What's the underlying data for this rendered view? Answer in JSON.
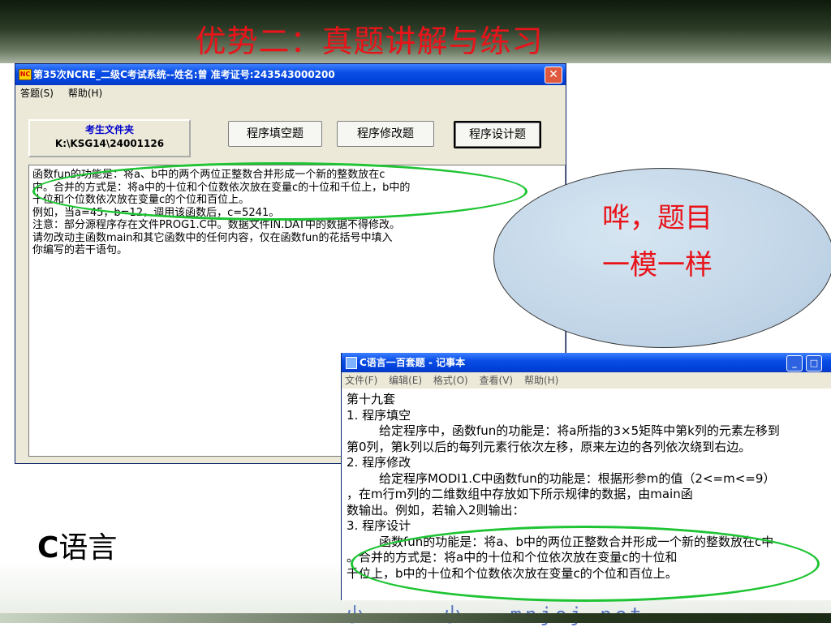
{
  "slide": {
    "title": "优势二：真题讲解与练习",
    "bubble_line1": "哗，题目",
    "bubble_line2": "一模一样",
    "lang_c": "C",
    "lang_rest": "语言"
  },
  "exam_window": {
    "title": "第35次NCRE_二级C考试系统--姓名:曾  准考证号:243543000200",
    "icon": "ncre-app-icon",
    "menu": [
      "答题(S)",
      "帮助(H)"
    ],
    "folder_label": "考生文件夹",
    "folder_path": "K:\\KSG14\\24001126",
    "tabs": [
      "程序填空题",
      "程序修改题",
      "程序设计题"
    ],
    "content": [
      "    函数fun的功能是：将a、b中的两个两位正整数合并形成一个新的整数放在c",
      "中。合并的方式是：将a中的十位和个位数依次放在变量c的十位和千位上，b中的",
      "十位和个位数依次放在变量c的个位和百位上。",
      "    例如，当a=45，b=12，调用该函数后，c=5241。",
      "    注意：部分源程序存在文件PROG1.C中。数据文件IN.DAT中的数据不得修改。",
      "    请勿改动主函数main和其它函数中的任何内容，仅在函数fun的花括号中填入",
      "你编写的若干语句。"
    ]
  },
  "notepad": {
    "title": "C语言一百套题 - 记事本",
    "menu": [
      "文件(F)",
      "编辑(E)",
      "格式(O)",
      "查看(V)",
      "帮助(H)"
    ],
    "lines": [
      {
        "t": "第十九套",
        "i": false
      },
      {
        "t": "1. 程序填空",
        "i": false
      },
      {
        "t": "给定程序中，函数fun的功能是：将a所指的3×5矩阵中第k列的元素左移到",
        "i": true
      },
      {
        "t": "第0列，第k列以后的每列元素行依次左移，原来左边的各列依次绕到右边。",
        "i": false
      },
      {
        "t": "2. 程序修改",
        "i": false
      },
      {
        "t": "给定程序MODI1.C中函数fun的功能是：根据形参m的值（2<=m<=9）",
        "i": true
      },
      {
        "t": "，在m行m列的二维数组中存放如下所示规律的数据，由main函",
        "i": false
      },
      {
        "t": "数输出。例如，若输入2则输出：",
        "i": false
      },
      {
        "t": "3. 程序设计",
        "i": false
      },
      {
        "t": "函数fun的功能是：将a、b中的两位正整数合并形成一个新的整数放在c中",
        "i": true
      },
      {
        "t": "。合并的方式是：将a中的十位和个位依次放在变量c的十位和",
        "i": false
      },
      {
        "t": "千位上，b中的十位和个位数依次放在变量c的个位和百位上。",
        "i": false
      }
    ]
  },
  "bottom_deco": "小     小   mnjoj.net    "
}
